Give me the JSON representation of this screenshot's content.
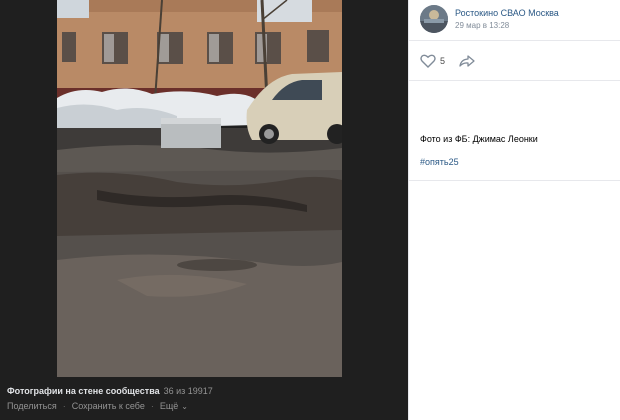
{
  "photo": {
    "description_icon": "street-photo"
  },
  "viewer_footer": {
    "album_title": "Фотографии на стене сообщества",
    "counter": "36 из 19917",
    "actions": {
      "share": "Поделиться",
      "save": "Сохранить к себе",
      "more": "Ещё"
    }
  },
  "post": {
    "author": "Ростокино СВАО Москва",
    "date": "29 мар в 13:28",
    "likes": "5",
    "caption": "Фото из ФБ: Джимас Леонки",
    "hashtag": "#опять25"
  },
  "icons": {
    "like": "heart-icon",
    "share": "share-arrow-icon",
    "more": "chevron-down-icon"
  },
  "colors": {
    "viewer_bg": "#1f1f1f",
    "link": "#2a5885",
    "meta": "#818c99"
  }
}
